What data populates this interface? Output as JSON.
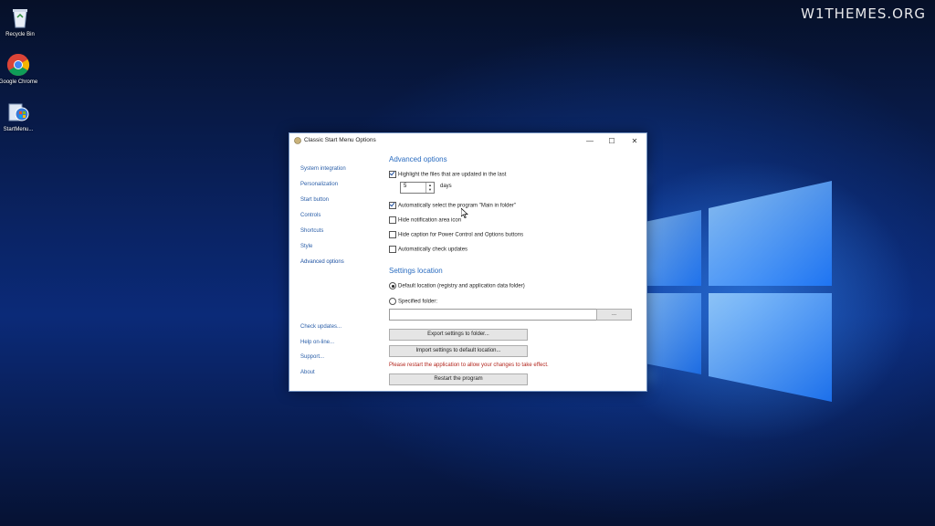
{
  "watermark": "W1THEMES.ORG",
  "desktop": {
    "icons": [
      {
        "label": "Recycle Bin",
        "icon": "recycle-bin-icon"
      },
      {
        "label": "Google Chrome",
        "icon": "chrome-icon"
      },
      {
        "label": "StartMenu...",
        "icon": "start-menu-setup-icon"
      }
    ]
  },
  "dialog": {
    "title": "Classic Start Menu Options",
    "controls": {
      "minimize": "—",
      "maximize": "☐",
      "close": "✕"
    },
    "nav": {
      "items": [
        "System integration",
        "Personalization",
        "Start button",
        "Controls",
        "Shortcuts",
        "Style",
        "Advanced options"
      ],
      "active": "Advanced options",
      "bottom": [
        "Check updates...",
        "Help on-line...",
        "Support...",
        "About"
      ]
    },
    "advanced": {
      "heading": "Advanced options",
      "highlight_label": "Highlight the files that are updated in the last",
      "highlight_checked": true,
      "days_value": "5",
      "days_label": "days",
      "auto_select_label": "Automatically select the program \"Main in folder\"",
      "auto_select_checked": true,
      "hide_notification_label": "Hide notification area icon",
      "hide_caption_label": "Hide caption for Power Control and Options buttons",
      "auto_check_updates_label": "Automatically check updates"
    },
    "settings_location": {
      "heading": "Settings location",
      "default_label": "Default location (registry and application data folder)",
      "default_selected": true,
      "specified_label": "Specified folder:",
      "folder_value": "",
      "browse_label": "...",
      "export_label": "Export settings to folder...",
      "import_label": "Import settings to default location...",
      "restart_warning": "Please restart the application to allow your changes to take effect.",
      "restart_label": "Restart the program"
    }
  },
  "colors": {
    "accent": "#2a6cc0",
    "warning": "#b3261e"
  }
}
